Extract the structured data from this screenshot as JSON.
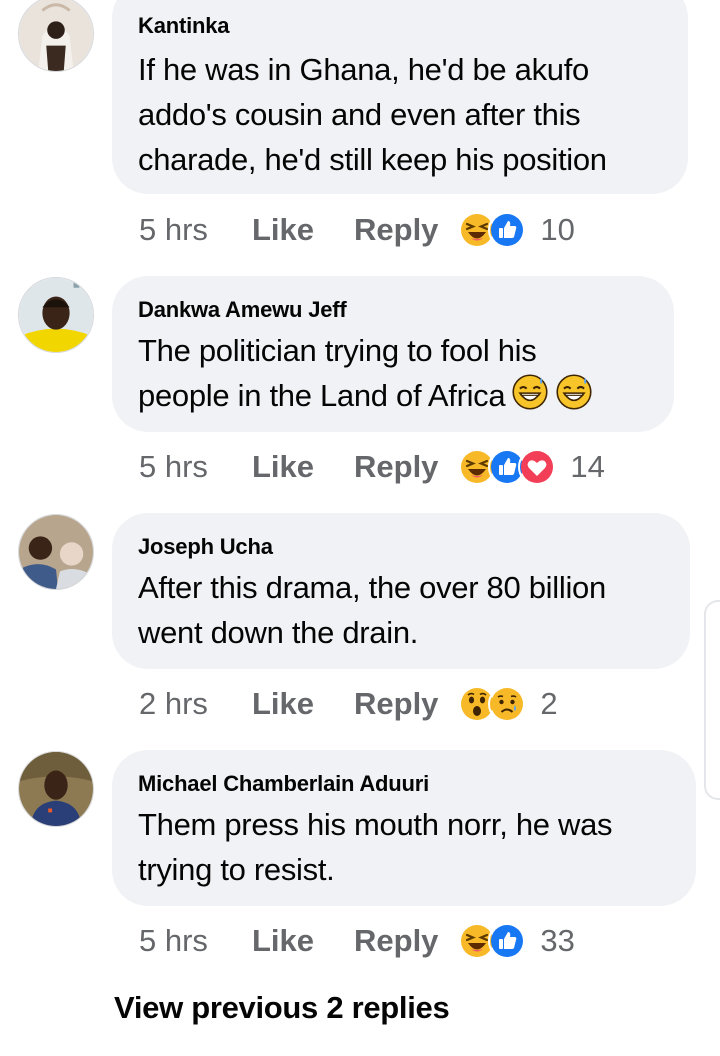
{
  "comments": [
    {
      "author": "Kantinka",
      "lines": [
        "If he was in Ghana, he'd be akufo",
        "addo's cousin and even after this",
        "charade, he'd still keep his position"
      ],
      "time": "5 hrs",
      "like_label": "Like",
      "reply_label": "Reply",
      "reactions": [
        "laughing-emoji-icon",
        "thumbs-up-icon"
      ],
      "reaction_count": "10"
    },
    {
      "author": "Dankwa Amewu Jeff",
      "lines": [
        "The politician trying to fool his",
        "people in the Land of Africa"
      ],
      "inline_emoji": [
        "sweat-smile-emoji-icon",
        "sweat-smile-emoji-icon"
      ],
      "time": "5 hrs",
      "like_label": "Like",
      "reply_label": "Reply",
      "reactions": [
        "laughing-emoji-icon",
        "thumbs-up-icon",
        "heart-icon"
      ],
      "reaction_count": "14"
    },
    {
      "author": "Joseph Ucha",
      "lines": [
        "After this drama, the over 80 billion",
        "went down the drain."
      ],
      "time": "2 hrs",
      "like_label": "Like",
      "reply_label": "Reply",
      "reactions": [
        "wow-emoji-icon",
        "sad-emoji-icon"
      ],
      "reaction_count": "2"
    },
    {
      "author": "Michael Chamberlain Aduuri",
      "lines": [
        "Them press his mouth norr, he was",
        "trying to resist."
      ],
      "time": "5 hrs",
      "like_label": "Like",
      "reply_label": "Reply",
      "reactions": [
        "laughing-emoji-icon",
        "thumbs-up-icon"
      ],
      "reaction_count": "33"
    }
  ],
  "view_previous": "View previous 2 replies",
  "colors": {
    "bubble": "#f0f2f5",
    "meta_text": "#65676b",
    "like_blue": "#1877f2",
    "love_red": "#f33e58",
    "haha_yellow": "#f7b125"
  }
}
